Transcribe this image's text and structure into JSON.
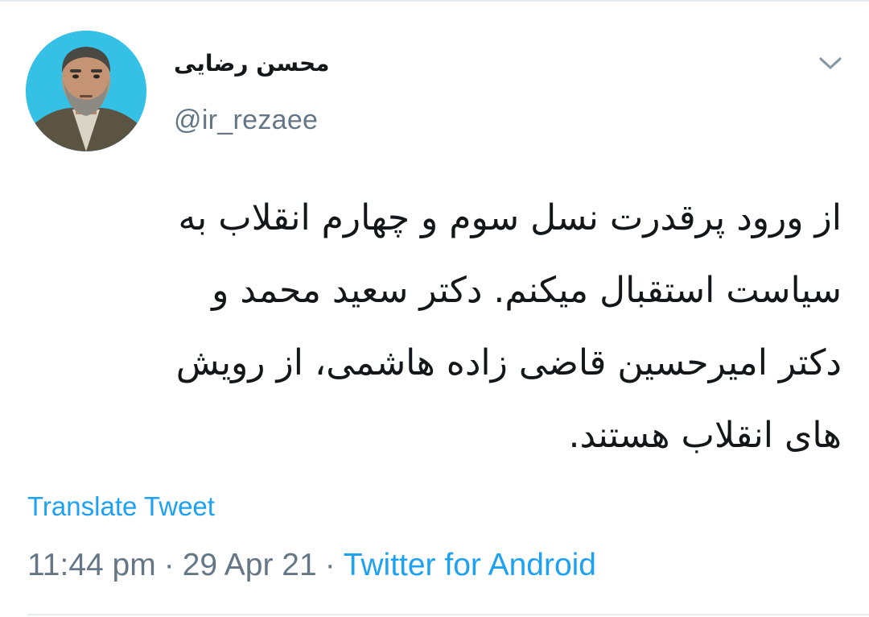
{
  "user": {
    "display_name": "محسن رضایی",
    "handle": "@ir_rezaee",
    "avatar_icon": "profile-photo"
  },
  "tweet": {
    "text_lines": [
      "از ورود پرقدرت نسل سوم و چهارم انقلاب به",
      "سیاست استقبال میکنم. دکتر سعید محمد و",
      "دکتر امیرحسین قاضی زاده هاشمی، از رویش",
      "های انقلاب هستند."
    ],
    "translate_label": "Translate Tweet",
    "time": "11:44 pm",
    "date": "29 Apr 21",
    "source": "Twitter for Android",
    "separator": "·"
  },
  "menu": {
    "caret_icon": "chevron-down-icon"
  },
  "colors": {
    "accent": "#1da1f2",
    "secondary_text": "#657786",
    "primary_text": "#14171a",
    "avatar_bg": "#35c0e6"
  }
}
